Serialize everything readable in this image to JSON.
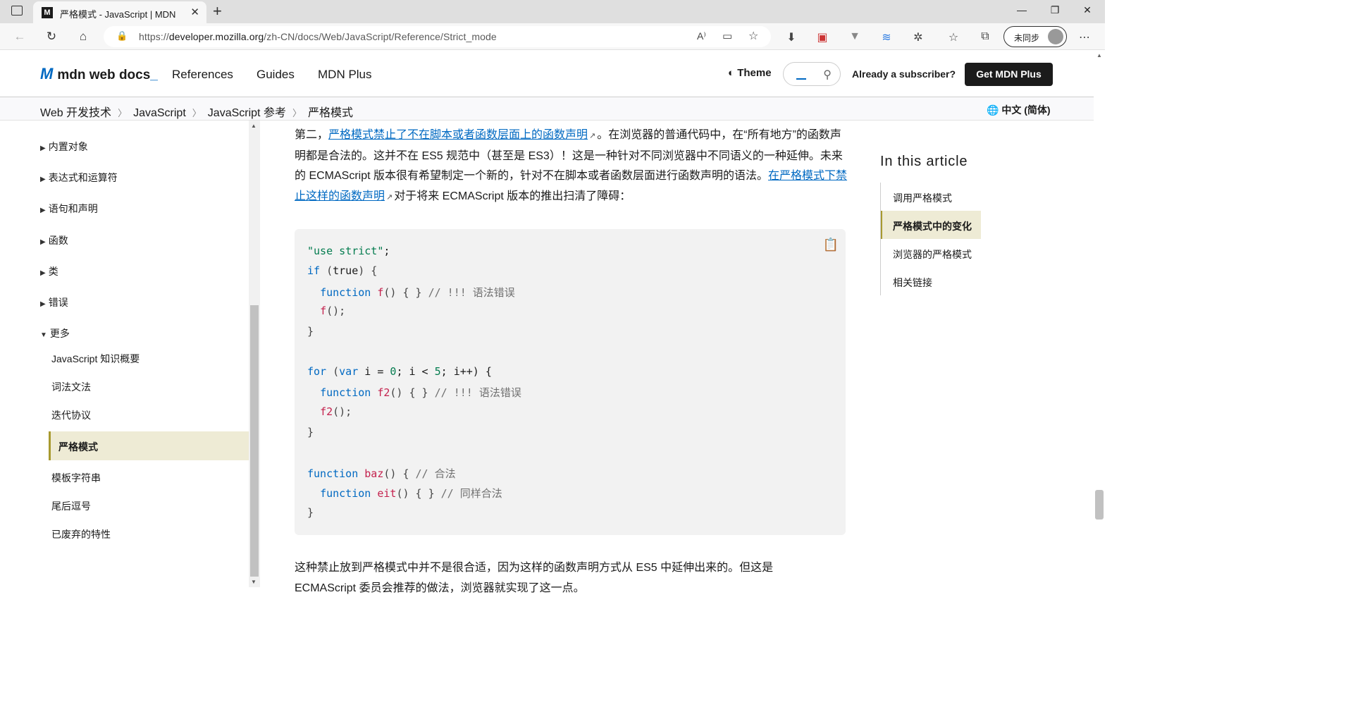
{
  "browser": {
    "tab_title": "严格模式 - JavaScript | MDN",
    "tab_favicon": "M",
    "url_prefix": "https://",
    "url_host": "developer.mozilla.org",
    "url_path": "/zh-CN/docs/Web/JavaScript/Reference/Strict_mode",
    "sync_label": "未同步"
  },
  "header": {
    "logo_text": "mdn web docs",
    "nav": [
      "References",
      "Guides",
      "MDN Plus"
    ],
    "theme_label": "Theme",
    "subscriber_text": "Already a subscriber?",
    "cta_label": "Get MDN Plus"
  },
  "breadcrumb": {
    "items": [
      "Web 开发技术",
      "JavaScript",
      "JavaScript 参考",
      "严格模式"
    ],
    "language": "中文 (简体)"
  },
  "sidebar": {
    "groups": [
      "内置对象",
      "表达式和运算符",
      "语句和声明",
      "函数",
      "类",
      "错误"
    ],
    "expanded_group": "更多",
    "sub_items": [
      "JavaScript 知识概要",
      "词法文法",
      "迭代协议"
    ],
    "active_item": "严格模式",
    "after_items": [
      "模板字符串",
      "尾后逗号",
      "已废弃的特性"
    ]
  },
  "article": {
    "p1_lead": "第二，",
    "p1_link1": "严格模式禁止了不在脚本或者函数层面上的函数声明",
    "p1_mid": "。在浏览器的普通代码中，在“所有地方”的函数声明都是合法的。这并不在 ES5 规范中（甚至是 ES3）！这是一种针对不同浏览器中不同语义的一种延伸。未来的 ECMAScript 版本很有希望制定一个新的，针对不在脚本或者函数层面进行函数声明的语法。",
    "p1_link2": "在严格模式下禁止这样的函数声明",
    "p1_tail": "对于将来 ECMAScript 版本的推出扫清了障碍：",
    "p2_line1": "这种禁止放到严格模式中并不是很合适，因为这样的函数声明方式从 ES5 中延伸出来的。但这是",
    "p2_line2": "ECMAScript 委员会推荐的做法，浏览器就实现了这一点。"
  },
  "code": {
    "l1_str": "\"use strict\"",
    "l1_end": ";",
    "l2_kw": "if",
    "l2_val": "true",
    "l3_kw": "function",
    "l3_fn": "f",
    "l3_rest": "() { }",
    "l3_cm": "// !!! 语法错误",
    "l4_fn": "f",
    "l4_rest": "();",
    "close": "}",
    "l7_kw": "for",
    "l7_var": "var",
    "l7_i": "i",
    "l7_eq": " = ",
    "l7_zero": "0",
    "l7_mid": "; i < ",
    "l7_five": "5",
    "l7_end": "; i++) {",
    "l8_kw": "function",
    "l8_fn": "f2",
    "l8_rest": "() { }",
    "l8_cm": "// !!! 语法错误",
    "l9_fn": "f2",
    "l9_rest": "();",
    "l12_kw": "function",
    "l12_fn": "baz",
    "l12_rest": "() {",
    "l12_cm": "// 合法",
    "l13_kw": "function",
    "l13_fn": "eit",
    "l13_rest": "() { }",
    "l13_cm": "// 同样合法"
  },
  "toc": {
    "title": "In this article",
    "items": [
      "调用严格模式",
      "严格模式中的变化",
      "浏览器的严格模式",
      "相关链接"
    ],
    "active_index": 1
  }
}
